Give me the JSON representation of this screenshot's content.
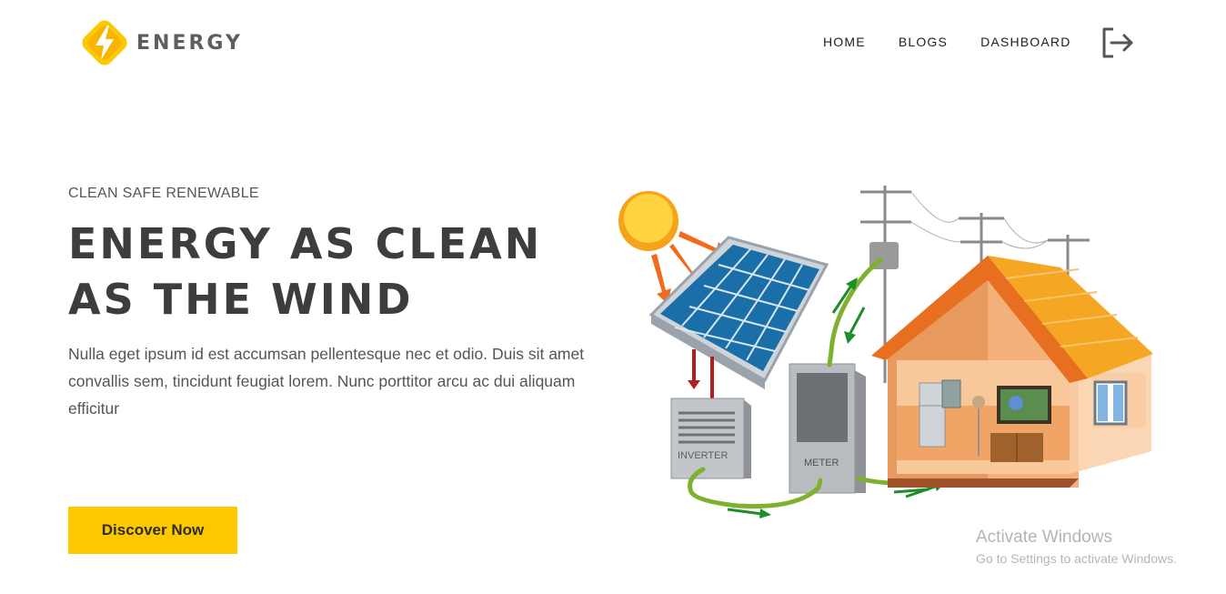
{
  "header": {
    "brand": "ENERGY",
    "nav": [
      {
        "label": "HOME"
      },
      {
        "label": "BLOGS"
      },
      {
        "label": "DASHBOARD"
      }
    ],
    "logout_icon": "logout-icon"
  },
  "hero": {
    "eyebrow": "CLEAN SAFE RENEWABLE",
    "headline": "ENERGY AS CLEAN AS THE WIND",
    "body": "Nulla eget ipsum id est accumsan pellentesque nec et odio. Duis sit amet convallis sem, tincidunt feugiat lorem. Nunc porttitor arcu ac dui aliquam efficitur",
    "cta_label": "Discover Now"
  },
  "illustration": {
    "inverter_label": "INVERTER",
    "meter_label": "METER"
  },
  "watermark": {
    "title": "Activate Windows",
    "subtitle": "Go to Settings to activate Windows."
  },
  "colors": {
    "accent": "#fcc800",
    "heading": "#3d3d3d",
    "body_text": "#555555",
    "roof": "#f5a623"
  }
}
